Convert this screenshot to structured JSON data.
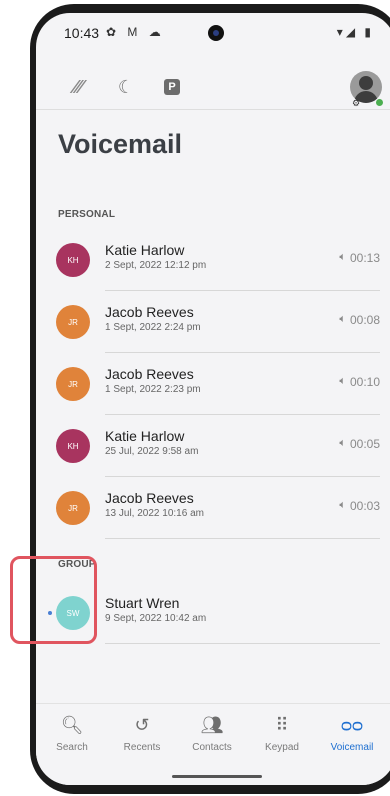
{
  "status_bar": {
    "time": "10:43",
    "left_icons": "✿ M ☁",
    "right_icons": "▾◢ ▮"
  },
  "page": {
    "title": "Voicemail"
  },
  "sections": {
    "personal_label": "PERSONAL",
    "group_label": "GROUP"
  },
  "personal": [
    {
      "initials": "KH",
      "name": "Katie Harlow",
      "date": "2 Sept, 2022 12:12 pm",
      "duration": "00:13",
      "color": "#a8345f"
    },
    {
      "initials": "JR",
      "name": "Jacob Reeves",
      "date": "1 Sept, 2022 2:24 pm",
      "duration": "00:08",
      "color": "#e0833a"
    },
    {
      "initials": "JR",
      "name": "Jacob Reeves",
      "date": "1 Sept, 2022 2:23 pm",
      "duration": "00:10",
      "color": "#e0833a"
    },
    {
      "initials": "KH",
      "name": "Katie Harlow",
      "date": "25 Jul, 2022 9:58 am",
      "duration": "00:05",
      "color": "#a8345f"
    },
    {
      "initials": "JR",
      "name": "Jacob Reeves",
      "date": "13 Jul, 2022 10:16 am",
      "duration": "00:03",
      "color": "#e0833a"
    }
  ],
  "group": [
    {
      "initials": "SW",
      "name": "Stuart Wren",
      "date": "9 Sept, 2022 10:42 am",
      "color": "#7fd3cf"
    }
  ],
  "nav": [
    {
      "label": "Search",
      "icon": "search-icon",
      "active": false
    },
    {
      "label": "Recents",
      "icon": "history-icon",
      "active": false
    },
    {
      "label": "Contacts",
      "icon": "contacts-icon",
      "active": false
    },
    {
      "label": "Keypad",
      "icon": "keypad-icon",
      "active": false
    },
    {
      "label": "Voicemail",
      "icon": "voicemail-icon",
      "active": true
    }
  ],
  "colors": {
    "accent": "#1e6fd0",
    "highlight": "#e0555f"
  }
}
